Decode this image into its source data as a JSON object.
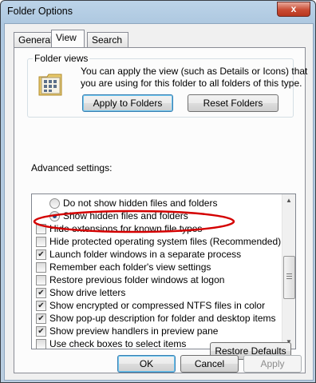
{
  "window": {
    "title": "Folder Options",
    "close_glyph": "x"
  },
  "tabs": [
    {
      "label": "General",
      "active": false
    },
    {
      "label": "View",
      "active": true
    },
    {
      "label": "Search",
      "active": false
    }
  ],
  "folder_views": {
    "group_label": "Folder views",
    "description_line1": "You can apply the view (such as Details or Icons) that",
    "description_line2": "you are using for this folder to all folders of this type.",
    "icon": "folder-grid-icon",
    "apply_button": "Apply to Folders",
    "reset_button": "Reset Folders"
  },
  "advanced": {
    "label": "Advanced settings:",
    "items": [
      {
        "type": "radio",
        "checked": false,
        "label": "Do not show hidden files and folders"
      },
      {
        "type": "radio",
        "checked": true,
        "label": "Show hidden files and folders"
      },
      {
        "type": "checkbox",
        "checked": false,
        "label": "Hide extensions for known file types"
      },
      {
        "type": "checkbox",
        "checked": false,
        "label": "Hide protected operating system files (Recommended)"
      },
      {
        "type": "checkbox",
        "checked": true,
        "label": "Launch folder windows in a separate process"
      },
      {
        "type": "checkbox",
        "checked": false,
        "label": "Remember each folder's view settings"
      },
      {
        "type": "checkbox",
        "checked": false,
        "label": "Restore previous folder windows at logon"
      },
      {
        "type": "checkbox",
        "checked": true,
        "label": "Show drive letters"
      },
      {
        "type": "checkbox",
        "checked": true,
        "label": "Show encrypted or compressed NTFS files in color"
      },
      {
        "type": "checkbox",
        "checked": true,
        "label": "Show pop-up description for folder and desktop items"
      },
      {
        "type": "checkbox",
        "checked": true,
        "label": "Show preview handlers in preview pane"
      },
      {
        "type": "checkbox",
        "checked": false,
        "label": "Use check boxes to select items"
      }
    ],
    "restore_defaults": "Restore Defaults"
  },
  "footer": {
    "ok": "OK",
    "cancel": "Cancel",
    "apply": "Apply"
  },
  "colors": {
    "highlight_ellipse": "#d40000",
    "window_frame": "#aec8e0"
  }
}
